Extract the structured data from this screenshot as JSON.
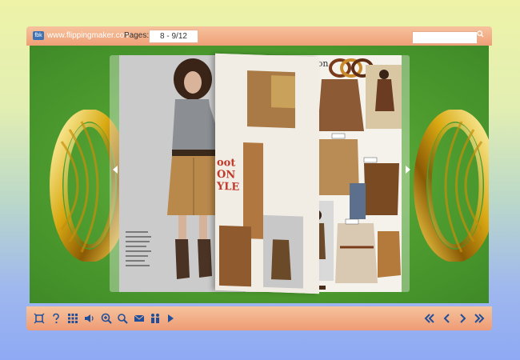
{
  "topbar": {
    "logo_text": "fbk",
    "site": "www.flippingmaker.com",
    "pages_label": "Pages:",
    "pages_value": "8 - 9/12",
    "search_placeholder": ""
  },
  "book": {
    "right_page_heading": "Fashion",
    "curl_text_1": "oot",
    "curl_text_2": "ON",
    "curl_text_3": "YLE"
  },
  "toolbar": {
    "left_buttons": [
      "fit-screen-icon",
      "help-icon",
      "thumbnails-icon",
      "sound-icon",
      "zoom-in-icon",
      "search-icon",
      "email-icon",
      "share-icon",
      "autoplay-icon"
    ],
    "right_buttons": [
      "first-page-icon",
      "previous-page-icon",
      "next-page-icon",
      "last-page-icon"
    ]
  },
  "colors": {
    "bar": "#ef9f77",
    "icon": "#1f4f9a",
    "stage": "#4f9d30"
  }
}
